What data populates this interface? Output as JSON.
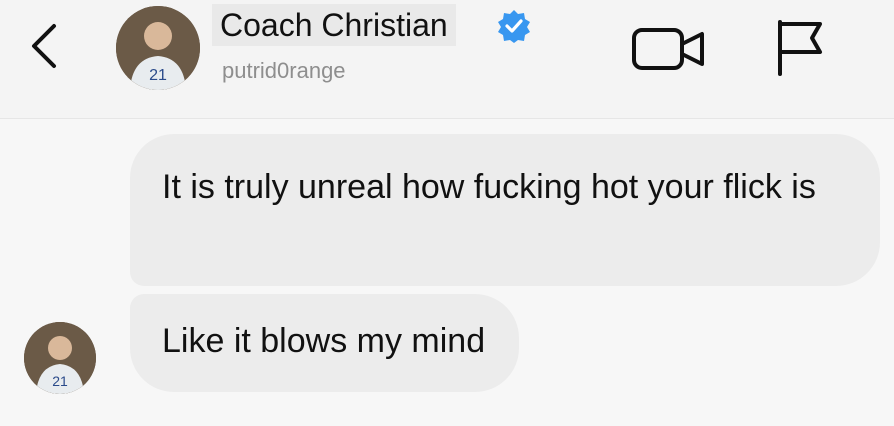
{
  "header": {
    "contact_name": "Coach Christian",
    "username": "putrid0range",
    "verified": true,
    "icons": {
      "back": "chevron-left-icon",
      "verified": "verified-badge-icon",
      "video": "video-camera-icon",
      "flag": "flag-icon"
    }
  },
  "messages": [
    {
      "text": "It is truly unreal how fucking hot your flick is"
    },
    {
      "text": "Like it blows my mind"
    }
  ],
  "colors": {
    "verified_badge": "#3897f0",
    "bubble": "#ececec",
    "username": "#8e8e8e"
  }
}
